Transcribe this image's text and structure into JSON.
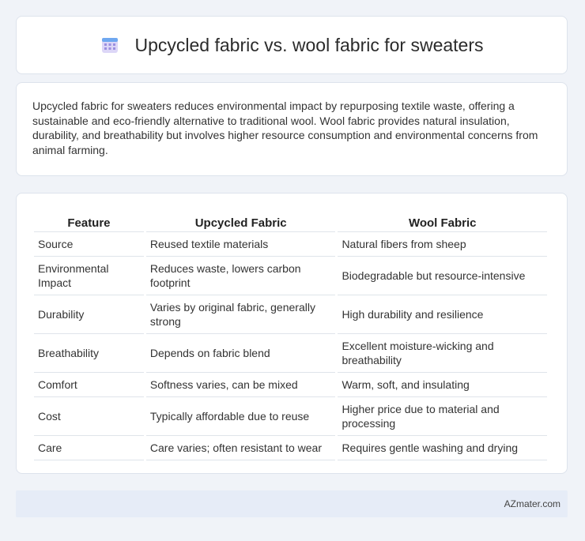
{
  "header": {
    "title": "Upcycled fabric vs. wool fabric for sweaters",
    "icon": "calendar-icon"
  },
  "intro": {
    "text": "Upcycled fabric for sweaters reduces environmental impact by repurposing textile waste, offering a sustainable and eco-friendly alternative to traditional wool. Wool fabric provides natural insulation, durability, and breathability but involves higher resource consumption and environmental concerns from animal farming."
  },
  "table": {
    "headers": [
      "Feature",
      "Upcycled Fabric",
      "Wool Fabric"
    ],
    "rows": [
      [
        "Source",
        "Reused textile materials",
        "Natural fibers from sheep"
      ],
      [
        "Environmental Impact",
        "Reduces waste, lowers carbon footprint",
        "Biodegradable but resource-intensive"
      ],
      [
        "Durability",
        "Varies by original fabric, generally strong",
        "High durability and resilience"
      ],
      [
        "Breathability",
        "Depends on fabric blend",
        "Excellent moisture-wicking and breathability"
      ],
      [
        "Comfort",
        "Softness varies, can be mixed",
        "Warm, soft, and insulating"
      ],
      [
        "Cost",
        "Typically affordable due to reuse",
        "Higher price due to material and processing"
      ],
      [
        "Care",
        "Care varies; often resistant to wear",
        "Requires gentle washing and drying"
      ]
    ]
  },
  "footer": {
    "brand": "AZmater.com"
  }
}
